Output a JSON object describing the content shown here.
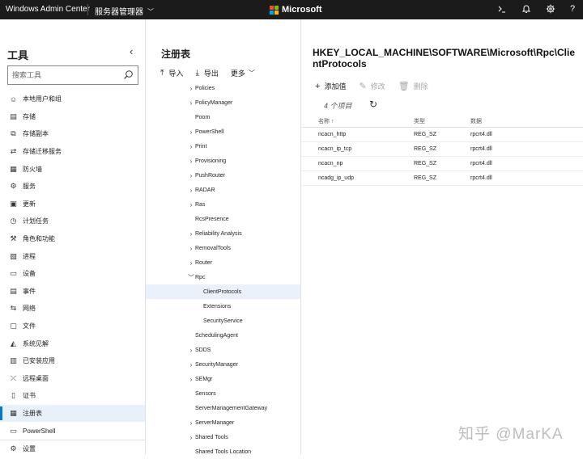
{
  "topbar": {
    "app_title": "Windows Admin Center",
    "server_menu": "服务器管理器",
    "brand": "Microsoft",
    "brand_colors": [
      "#f25022",
      "#7fba00",
      "#00a4ef",
      "#ffb900"
    ],
    "icons": [
      "terminal-icon",
      "bell-icon",
      "gear-icon",
      "help-icon"
    ]
  },
  "sidebar": {
    "title": "工具",
    "search_placeholder": "搜索工具",
    "items": [
      {
        "label": "本地用户和组",
        "icon": "users-icon",
        "glyph": "☺"
      },
      {
        "label": "存储",
        "icon": "storage-icon",
        "glyph": "▤"
      },
      {
        "label": "存储副本",
        "icon": "storage-replica-icon",
        "glyph": "⧉"
      },
      {
        "label": "存储迁移服务",
        "icon": "migration-icon",
        "glyph": "⇄"
      },
      {
        "label": "防火墙",
        "icon": "firewall-icon",
        "glyph": "▦"
      },
      {
        "label": "服务",
        "icon": "services-icon",
        "glyph": "⚙"
      },
      {
        "label": "更新",
        "icon": "updates-icon",
        "glyph": "▣"
      },
      {
        "label": "计划任务",
        "icon": "scheduled-tasks-icon",
        "glyph": "◷"
      },
      {
        "label": "角色和功能",
        "icon": "roles-features-icon",
        "glyph": "⚒"
      },
      {
        "label": "进程",
        "icon": "processes-icon",
        "glyph": "▧"
      },
      {
        "label": "设备",
        "icon": "devices-icon",
        "glyph": "▭"
      },
      {
        "label": "事件",
        "icon": "events-icon",
        "glyph": "▤"
      },
      {
        "label": "网络",
        "icon": "network-icon",
        "glyph": "⇆"
      },
      {
        "label": "文件",
        "icon": "files-icon",
        "glyph": "▢"
      },
      {
        "label": "系统见解",
        "icon": "system-insights-icon",
        "glyph": "◭"
      },
      {
        "label": "已安装应用",
        "icon": "installed-apps-icon",
        "glyph": "▥"
      },
      {
        "label": "远程桌面",
        "icon": "remote-desktop-icon",
        "glyph": "⤫"
      },
      {
        "label": "证书",
        "icon": "certificates-icon",
        "glyph": "▯"
      },
      {
        "label": "注册表",
        "icon": "registry-icon",
        "glyph": "▦",
        "active": true
      },
      {
        "label": "PowerShell",
        "icon": "powershell-icon",
        "glyph": "▭"
      }
    ],
    "settings_label": "设置"
  },
  "tree_panel": {
    "title": "注册表",
    "toolbar": {
      "import": "导入",
      "export": "导出",
      "more": "更多"
    },
    "items": [
      {
        "label": "Policies",
        "expandable": true,
        "level": 0
      },
      {
        "label": "PolicyManager",
        "expandable": true,
        "level": 0
      },
      {
        "label": "Poom",
        "expandable": false,
        "level": 0
      },
      {
        "label": "PowerShell",
        "expandable": true,
        "level": 0
      },
      {
        "label": "Print",
        "expandable": true,
        "level": 0
      },
      {
        "label": "Provisioning",
        "expandable": true,
        "level": 0
      },
      {
        "label": "PushRouter",
        "expandable": true,
        "level": 0
      },
      {
        "label": "RADAR",
        "expandable": true,
        "level": 0
      },
      {
        "label": "Ras",
        "expandable": true,
        "level": 0
      },
      {
        "label": "RcsPresence",
        "expandable": false,
        "level": 0
      },
      {
        "label": "Reliability Analysis",
        "expandable": true,
        "level": 0
      },
      {
        "label": "RemovalTools",
        "expandable": true,
        "level": 0
      },
      {
        "label": "Router",
        "expandable": true,
        "level": 0
      },
      {
        "label": "Rpc",
        "expandable": true,
        "expanded": true,
        "level": 0
      },
      {
        "label": "ClientProtocols",
        "expandable": false,
        "level": 1,
        "selected": true
      },
      {
        "label": "Extensions",
        "expandable": false,
        "level": 1
      },
      {
        "label": "SecurityService",
        "expandable": false,
        "level": 1
      },
      {
        "label": "SchedulingAgent",
        "expandable": false,
        "level": 0
      },
      {
        "label": "SDDS",
        "expandable": true,
        "level": 0
      },
      {
        "label": "SecurityManager",
        "expandable": true,
        "level": 0
      },
      {
        "label": "SEMgr",
        "expandable": true,
        "level": 0
      },
      {
        "label": "Sensors",
        "expandable": false,
        "level": 0
      },
      {
        "label": "ServerManagementGateway",
        "expandable": false,
        "level": 0
      },
      {
        "label": "ServerManager",
        "expandable": true,
        "level": 0
      },
      {
        "label": "Shared Tools",
        "expandable": true,
        "level": 0
      },
      {
        "label": "Shared Tools Location",
        "expandable": false,
        "level": 0
      }
    ]
  },
  "detail": {
    "path": "HKEY_LOCAL_MACHINE\\SOFTWARE\\Microsoft\\Rpc\\ClientProtocols",
    "actions": {
      "add": "添加值",
      "edit": "修改",
      "delete": "删除"
    },
    "count": "4 个项目",
    "columns": {
      "name": "名称 ↑",
      "type": "类型",
      "data": "数据"
    },
    "rows": [
      {
        "name": "ncacn_http",
        "type": "REG_SZ",
        "data": "rpcrt4.dll"
      },
      {
        "name": "ncacn_ip_tcp",
        "type": "REG_SZ",
        "data": "rpcrt4.dll"
      },
      {
        "name": "ncacn_np",
        "type": "REG_SZ",
        "data": "rpcrt4.dll"
      },
      {
        "name": "ncadg_ip_udp",
        "type": "REG_SZ",
        "data": "rpcrt4.dll"
      }
    ]
  },
  "watermark": "知乎 @MarKA"
}
